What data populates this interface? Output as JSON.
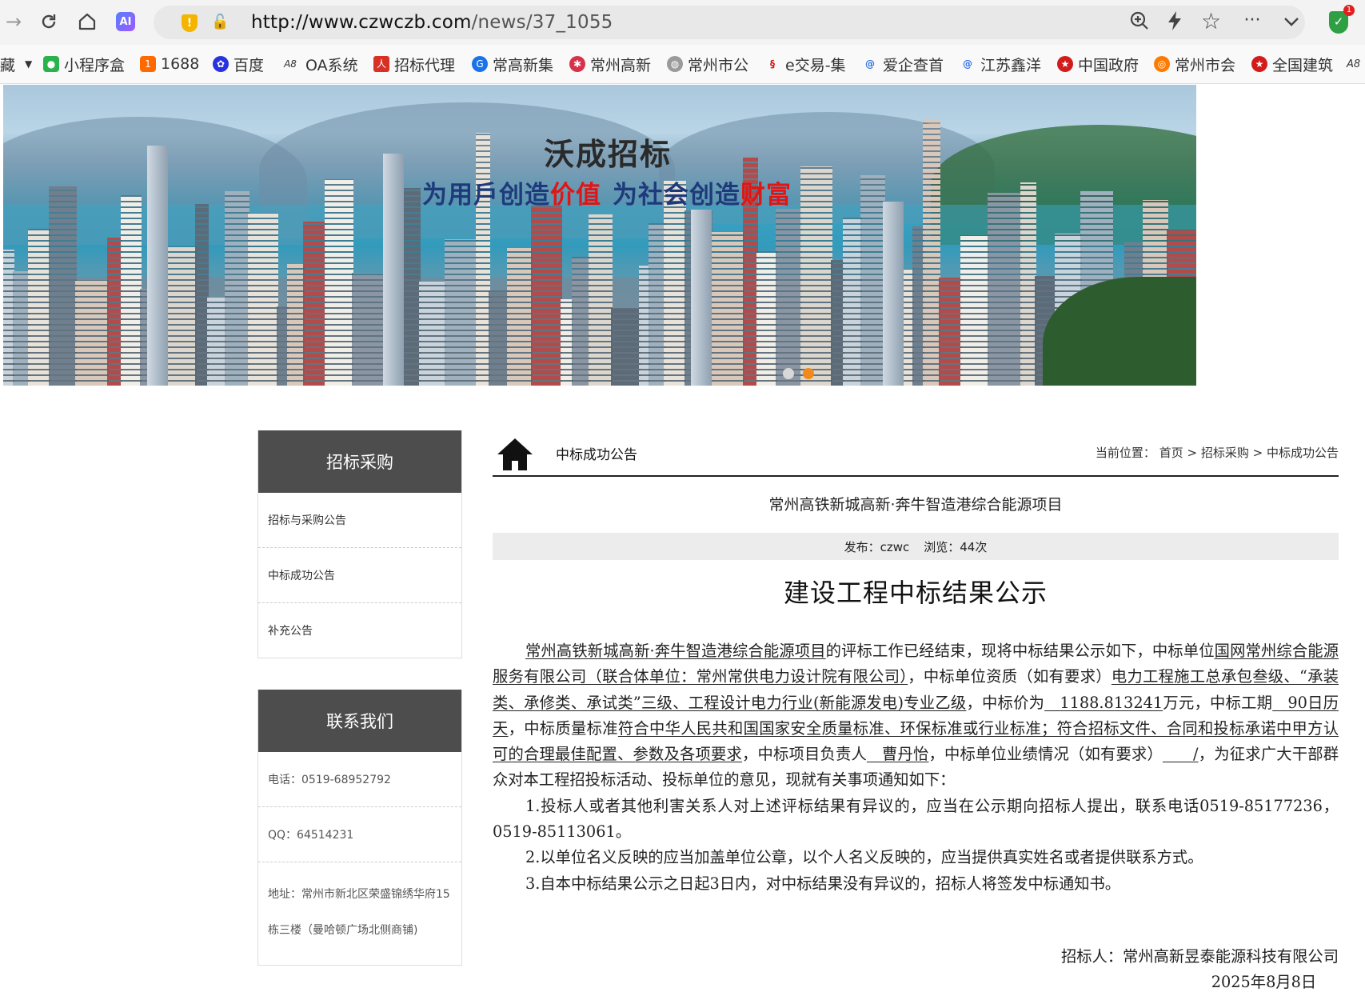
{
  "browser": {
    "url_host": "http://www.czwczb.com",
    "url_path": "/news/37_1055",
    "bookmarks": [
      "藏",
      "小程序盒",
      "1688",
      "百度",
      "OA系统",
      "招标代理",
      "常高新集",
      "常州高新",
      "常州市公",
      "e交易-集",
      "爱企查首",
      "江苏鑫洋",
      "中国政府",
      "常州市会",
      "全国建筑"
    ],
    "ext_badge": "1"
  },
  "banner": {
    "title": "沃成招标",
    "slogan_1": "为用戶创造",
    "slogan_red_1": "价值",
    "slogan_2": "为社会创造",
    "slogan_red_2": "财富"
  },
  "sidebar": {
    "nav_title": "招标采购",
    "nav_items": [
      "招标与采购公告",
      "中标成功公告",
      "补充公告"
    ],
    "contact_title": "联系我们",
    "phone": "电话：0519-68952792",
    "qq": "QQ：64514231",
    "address_1": "地址：常州市新北区荣盛锦绣华府15",
    "address_2": "栋三楼（曼哈顿广场北侧商铺)"
  },
  "header": {
    "section_title": "中标成功公告",
    "breadcrumb_label": "当前位置：",
    "breadcrumb": [
      "首页",
      "招标采购",
      "中标成功公告"
    ]
  },
  "article": {
    "project_name": "常州高铁新城高新·奔牛智造港综合能源项目",
    "meta_publisher": "发布：czwc",
    "meta_views": "浏览：44次",
    "title": "建设工程中标结果公示",
    "p1_project": "常州高铁新城高新·奔牛智造港综合能源项目",
    "p1_a": "的评标工作已经结束，现将中标结果公示如下，中标单位",
    "p1_winner": "国网常州综合能源服务有限公司（联合体单位：常州常供电力设计院有限公司）",
    "p1_b": "，中标单位资质（如有要求）",
    "p1_qual": "电力工程施工总承包叁级、“承装类、承修类、承试类”三级、工程设计电力行业(新能源发电)专业乙级",
    "p1_c": "，中标价为",
    "p1_price": "1188.813241",
    "p1_d": "万元，中标工期",
    "p1_period": "90日历天",
    "p1_e": "，中标质量标准",
    "p1_quality": "符合中华人民共和国国家安全质量标准、环保标准或行业标准；符合招标文件、合同和投标承诺中甲方认可的合理最佳配置、参数及各项要求",
    "p1_f": "，中标项目负责人",
    "p1_manager": "曹丹怡",
    "p1_g": "，中标单位业绩情况（如有要求）",
    "p1_perf": "/",
    "p1_h": "，为征求广大干部群众对本工程招投标活动、投标单位的意见，现就有关事项通知如下：",
    "item1": "1.投标人或者其他利害关系人对上述评标结果有异议的，应当在公示期向招标人提出，联系电话0519-85177236，0519-85113061。",
    "item2": "2.以单位名义反映的应当加盖单位公章，以个人名义反映的，应当提供真实姓名或者提供联系方式。",
    "item3": "3.自本中标结果公示之日起3日内，对中标结果没有异议的，招标人将签发中标通知书。",
    "signer": "招标人：常州高新昱泰能源科技有限公司",
    "date": "2025年8月8日"
  }
}
